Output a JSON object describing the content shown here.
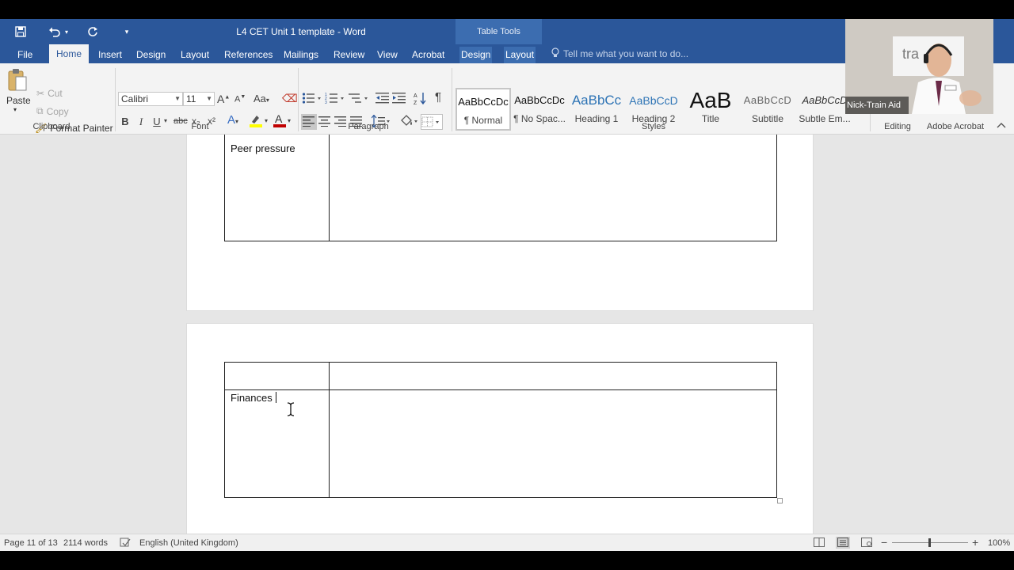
{
  "window": {
    "title": "L4 CET Unit 1 template - Word",
    "context_tab_group": "Table Tools"
  },
  "tabs": [
    {
      "label": "File"
    },
    {
      "label": "Home"
    },
    {
      "label": "Insert"
    },
    {
      "label": "Design"
    },
    {
      "label": "Layout"
    },
    {
      "label": "References"
    },
    {
      "label": "Mailings"
    },
    {
      "label": "Review"
    },
    {
      "label": "View"
    },
    {
      "label": "Acrobat"
    },
    {
      "label": "Design"
    },
    {
      "label": "Layout"
    }
  ],
  "tellme": {
    "placeholder": "Tell me what you want to do..."
  },
  "ribbon": {
    "clipboard": {
      "paste": "Paste",
      "cut": "Cut",
      "copy": "Copy",
      "format_painter": "Format Painter",
      "label": "Clipboard"
    },
    "font": {
      "family": "Calibri",
      "size": "11",
      "label": "Font",
      "bold": "B",
      "italic": "I",
      "underline": "U",
      "strike": "abc",
      "subscript": "x₂",
      "superscript": "x²",
      "change_case": "Aa",
      "grow": "A",
      "shrink": "A"
    },
    "paragraph": {
      "label": "Paragraph"
    },
    "styles": {
      "label": "Styles",
      "items": [
        {
          "preview": "AaBbCcDc",
          "name": "¶ Normal"
        },
        {
          "preview": "AaBbCcDc",
          "name": "¶ No Spac..."
        },
        {
          "preview": "AaBbCc",
          "name": "Heading 1"
        },
        {
          "preview": "AaBbCcD",
          "name": "Heading 2"
        },
        {
          "preview": "AaB",
          "name": "Title"
        },
        {
          "preview": "AaBbCcD",
          "name": "Subtitle"
        },
        {
          "preview": "AaBbCcD",
          "name": "Subtle Em..."
        }
      ]
    },
    "editing": {
      "label": "Editing"
    },
    "adobe": {
      "label": "Adobe Acrobat"
    }
  },
  "document": {
    "row_peer": "Peer pressure",
    "row_finances": "Finances"
  },
  "status": {
    "page": "Page 11 of 13",
    "words": "2114 words",
    "language": "English (United Kingdom)",
    "zoom": "100%"
  },
  "webcam": {
    "name": "Nick-Train Aid",
    "sign": "tra"
  },
  "colors": {
    "word_blue": "#2b579a",
    "ribbon_bg": "#f3f3f3",
    "canvas_bg": "#e6e6e6"
  }
}
